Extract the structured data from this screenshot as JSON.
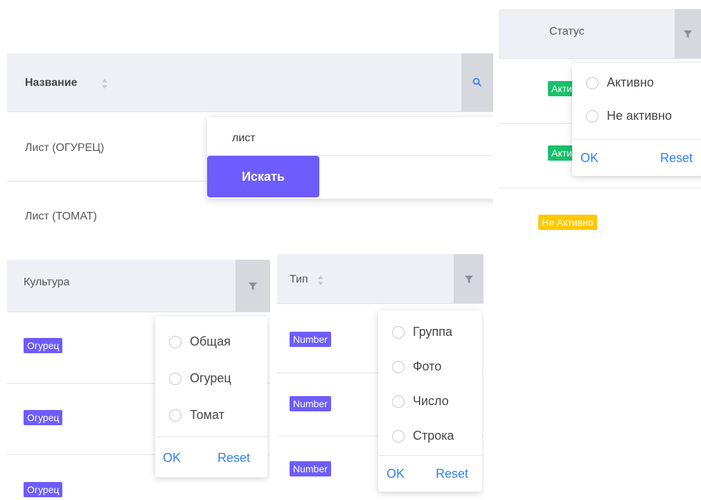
{
  "name_panel": {
    "header": "Название",
    "rows": [
      "Лист (ОГУРЕЦ)",
      "Лист (ТОМАТ)"
    ],
    "search": {
      "value": "лист",
      "button_label": "Искать"
    }
  },
  "status_panel": {
    "header": "Статус",
    "rows": [
      "Активно",
      "Активно",
      "Не Активно"
    ],
    "filter": {
      "options": [
        "Активно",
        "Не активно"
      ],
      "ok": "OK",
      "reset": "Reset"
    }
  },
  "culture_panel": {
    "header": "Культура",
    "rows": [
      "Огурец",
      "Огурец",
      "Огурец"
    ],
    "filter": {
      "options": [
        "Общая",
        "Огурец",
        "Томат"
      ],
      "ok": "OK",
      "reset": "Reset"
    }
  },
  "type_panel": {
    "header": "Тип",
    "rows": [
      "Number",
      "Number",
      "Number"
    ],
    "filter": {
      "options": [
        "Группа",
        "Фото",
        "Число",
        "Строка"
      ],
      "ok": "OK",
      "reset": "Reset"
    }
  },
  "colors": {
    "accent_purple": "#6d5dfc",
    "status_active": "#19c06b",
    "status_inactive": "#ffc800",
    "link_blue": "#2d7ff9",
    "header_bg": "#eef0f5"
  }
}
